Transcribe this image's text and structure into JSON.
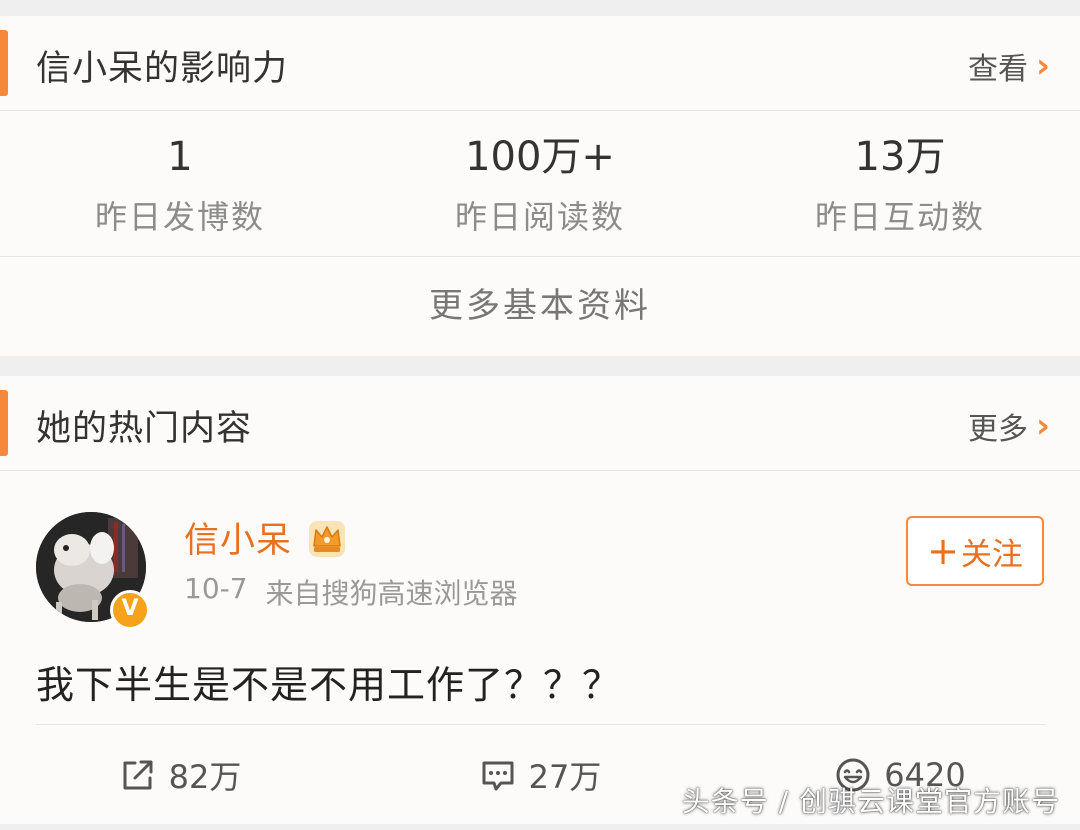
{
  "influence": {
    "title": "信小呆的影响力",
    "link_label": "查看",
    "stats": [
      {
        "value": "1",
        "label": "昨日发博数"
      },
      {
        "value": "100万+",
        "label": "昨日阅读数"
      },
      {
        "value": "13万",
        "label": "昨日互动数"
      }
    ],
    "more_info_label": "更多基本资料"
  },
  "hot": {
    "title": "她的热门内容",
    "link_label": "更多",
    "post": {
      "user_name": "信小呆",
      "date": "10-7",
      "source": "来自搜狗高速浏览器",
      "follow_plus": "+",
      "follow_label": "关注",
      "verified_mark": "V",
      "text": "我下半生是不是不用工作了？？？",
      "reposts": "82万",
      "comments": "27万",
      "likes": "6420"
    }
  },
  "watermark": "头条号 / 创骐云课堂官方账号",
  "colors": {
    "accent": "#f5883a",
    "username": "#e9701f",
    "badge": "#f7a21b"
  }
}
